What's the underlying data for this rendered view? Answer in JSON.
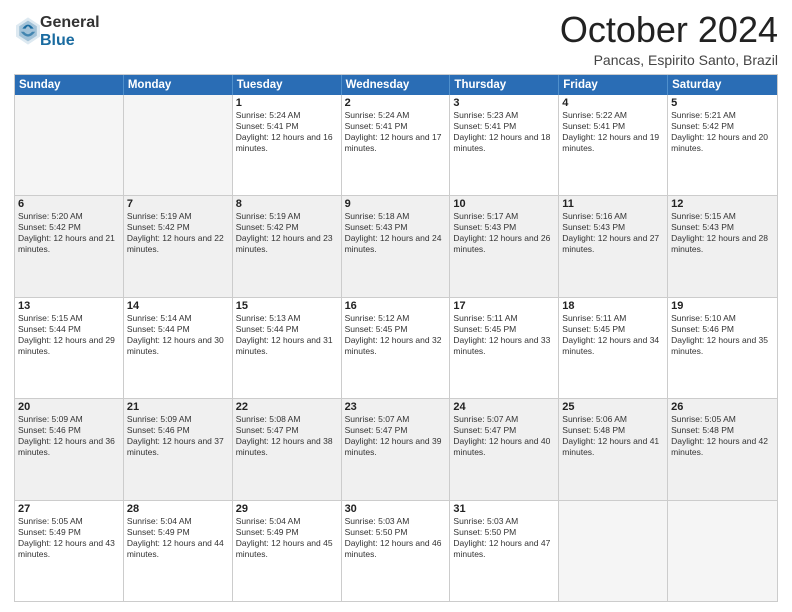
{
  "logo": {
    "general": "General",
    "blue": "Blue"
  },
  "header": {
    "month": "October 2024",
    "location": "Pancas, Espirito Santo, Brazil"
  },
  "days": [
    "Sunday",
    "Monday",
    "Tuesday",
    "Wednesday",
    "Thursday",
    "Friday",
    "Saturday"
  ],
  "weeks": [
    [
      {
        "day": "",
        "empty": true
      },
      {
        "day": "",
        "empty": true
      },
      {
        "day": "1",
        "sunrise": "Sunrise: 5:24 AM",
        "sunset": "Sunset: 5:41 PM",
        "daylight": "Daylight: 12 hours and 16 minutes."
      },
      {
        "day": "2",
        "sunrise": "Sunrise: 5:24 AM",
        "sunset": "Sunset: 5:41 PM",
        "daylight": "Daylight: 12 hours and 17 minutes."
      },
      {
        "day": "3",
        "sunrise": "Sunrise: 5:23 AM",
        "sunset": "Sunset: 5:41 PM",
        "daylight": "Daylight: 12 hours and 18 minutes."
      },
      {
        "day": "4",
        "sunrise": "Sunrise: 5:22 AM",
        "sunset": "Sunset: 5:41 PM",
        "daylight": "Daylight: 12 hours and 19 minutes."
      },
      {
        "day": "5",
        "sunrise": "Sunrise: 5:21 AM",
        "sunset": "Sunset: 5:42 PM",
        "daylight": "Daylight: 12 hours and 20 minutes."
      }
    ],
    [
      {
        "day": "6",
        "sunrise": "Sunrise: 5:20 AM",
        "sunset": "Sunset: 5:42 PM",
        "daylight": "Daylight: 12 hours and 21 minutes."
      },
      {
        "day": "7",
        "sunrise": "Sunrise: 5:19 AM",
        "sunset": "Sunset: 5:42 PM",
        "daylight": "Daylight: 12 hours and 22 minutes."
      },
      {
        "day": "8",
        "sunrise": "Sunrise: 5:19 AM",
        "sunset": "Sunset: 5:42 PM",
        "daylight": "Daylight: 12 hours and 23 minutes."
      },
      {
        "day": "9",
        "sunrise": "Sunrise: 5:18 AM",
        "sunset": "Sunset: 5:43 PM",
        "daylight": "Daylight: 12 hours and 24 minutes."
      },
      {
        "day": "10",
        "sunrise": "Sunrise: 5:17 AM",
        "sunset": "Sunset: 5:43 PM",
        "daylight": "Daylight: 12 hours and 26 minutes."
      },
      {
        "day": "11",
        "sunrise": "Sunrise: 5:16 AM",
        "sunset": "Sunset: 5:43 PM",
        "daylight": "Daylight: 12 hours and 27 minutes."
      },
      {
        "day": "12",
        "sunrise": "Sunrise: 5:15 AM",
        "sunset": "Sunset: 5:43 PM",
        "daylight": "Daylight: 12 hours and 28 minutes."
      }
    ],
    [
      {
        "day": "13",
        "sunrise": "Sunrise: 5:15 AM",
        "sunset": "Sunset: 5:44 PM",
        "daylight": "Daylight: 12 hours and 29 minutes."
      },
      {
        "day": "14",
        "sunrise": "Sunrise: 5:14 AM",
        "sunset": "Sunset: 5:44 PM",
        "daylight": "Daylight: 12 hours and 30 minutes."
      },
      {
        "day": "15",
        "sunrise": "Sunrise: 5:13 AM",
        "sunset": "Sunset: 5:44 PM",
        "daylight": "Daylight: 12 hours and 31 minutes."
      },
      {
        "day": "16",
        "sunrise": "Sunrise: 5:12 AM",
        "sunset": "Sunset: 5:45 PM",
        "daylight": "Daylight: 12 hours and 32 minutes."
      },
      {
        "day": "17",
        "sunrise": "Sunrise: 5:11 AM",
        "sunset": "Sunset: 5:45 PM",
        "daylight": "Daylight: 12 hours and 33 minutes."
      },
      {
        "day": "18",
        "sunrise": "Sunrise: 5:11 AM",
        "sunset": "Sunset: 5:45 PM",
        "daylight": "Daylight: 12 hours and 34 minutes."
      },
      {
        "day": "19",
        "sunrise": "Sunrise: 5:10 AM",
        "sunset": "Sunset: 5:46 PM",
        "daylight": "Daylight: 12 hours and 35 minutes."
      }
    ],
    [
      {
        "day": "20",
        "sunrise": "Sunrise: 5:09 AM",
        "sunset": "Sunset: 5:46 PM",
        "daylight": "Daylight: 12 hours and 36 minutes."
      },
      {
        "day": "21",
        "sunrise": "Sunrise: 5:09 AM",
        "sunset": "Sunset: 5:46 PM",
        "daylight": "Daylight: 12 hours and 37 minutes."
      },
      {
        "day": "22",
        "sunrise": "Sunrise: 5:08 AM",
        "sunset": "Sunset: 5:47 PM",
        "daylight": "Daylight: 12 hours and 38 minutes."
      },
      {
        "day": "23",
        "sunrise": "Sunrise: 5:07 AM",
        "sunset": "Sunset: 5:47 PM",
        "daylight": "Daylight: 12 hours and 39 minutes."
      },
      {
        "day": "24",
        "sunrise": "Sunrise: 5:07 AM",
        "sunset": "Sunset: 5:47 PM",
        "daylight": "Daylight: 12 hours and 40 minutes."
      },
      {
        "day": "25",
        "sunrise": "Sunrise: 5:06 AM",
        "sunset": "Sunset: 5:48 PM",
        "daylight": "Daylight: 12 hours and 41 minutes."
      },
      {
        "day": "26",
        "sunrise": "Sunrise: 5:05 AM",
        "sunset": "Sunset: 5:48 PM",
        "daylight": "Daylight: 12 hours and 42 minutes."
      }
    ],
    [
      {
        "day": "27",
        "sunrise": "Sunrise: 5:05 AM",
        "sunset": "Sunset: 5:49 PM",
        "daylight": "Daylight: 12 hours and 43 minutes."
      },
      {
        "day": "28",
        "sunrise": "Sunrise: 5:04 AM",
        "sunset": "Sunset: 5:49 PM",
        "daylight": "Daylight: 12 hours and 44 minutes."
      },
      {
        "day": "29",
        "sunrise": "Sunrise: 5:04 AM",
        "sunset": "Sunset: 5:49 PM",
        "daylight": "Daylight: 12 hours and 45 minutes."
      },
      {
        "day": "30",
        "sunrise": "Sunrise: 5:03 AM",
        "sunset": "Sunset: 5:50 PM",
        "daylight": "Daylight: 12 hours and 46 minutes."
      },
      {
        "day": "31",
        "sunrise": "Sunrise: 5:03 AM",
        "sunset": "Sunset: 5:50 PM",
        "daylight": "Daylight: 12 hours and 47 minutes."
      },
      {
        "day": "",
        "empty": true
      },
      {
        "day": "",
        "empty": true
      }
    ]
  ]
}
